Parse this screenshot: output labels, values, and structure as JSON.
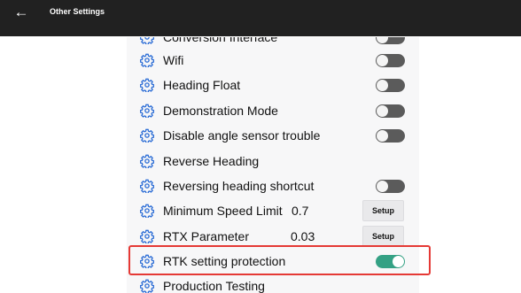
{
  "header": {
    "title": "Other Settings",
    "back_icon": "arrow-left-icon"
  },
  "settings": [
    {
      "label": "Conversion Interface",
      "control": "toggle",
      "on": false
    },
    {
      "label": "Wifi",
      "control": "toggle",
      "on": false
    },
    {
      "label": "Heading Float",
      "control": "toggle",
      "on": false
    },
    {
      "label": "Demonstration Mode",
      "control": "toggle",
      "on": false
    },
    {
      "label": "Disable angle sensor trouble",
      "control": "toggle",
      "on": false
    },
    {
      "label": "Reverse Heading",
      "control": "none"
    },
    {
      "label": "Reversing heading shortcut",
      "control": "toggle",
      "on": false
    },
    {
      "label": "Minimum Speed Limit",
      "value": "0.7",
      "control": "button",
      "button_label": "Setup"
    },
    {
      "label": "RTX Parameter",
      "value": "0.03",
      "control": "button",
      "button_label": "Setup"
    },
    {
      "label": "RTK setting protection",
      "control": "toggle",
      "on": true,
      "highlighted": true
    },
    {
      "label": "Production Testing",
      "control": "none"
    }
  ],
  "colors": {
    "topbar": "#212121",
    "icon": "#2f6fd6",
    "toggle_on": "#34a184",
    "toggle_off": "#5b5b5b",
    "highlight": "#e53935"
  }
}
